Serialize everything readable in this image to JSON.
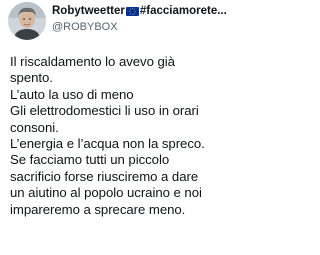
{
  "author": {
    "display_name": "Robytweetter",
    "hashtag": "#facciamorete...",
    "handle": "@ROBYBOX",
    "avatar_icon": "user-avatar-photo",
    "flag_icon": "eu-flag-icon"
  },
  "tweet": {
    "lines": [
      "Il riscaldamento lo avevo già",
      "spento.",
      "L’auto la uso di meno",
      "Gli elettrodomestici li uso in orari",
      "consoni.",
      "L’energia e l’acqua non la spreco.",
      "Se facciamo tutti un piccolo",
      "sacrificio forse riusciremo a dare",
      "un aiutino al popolo ucraino e noi",
      "impareremo a sprecare meno."
    ]
  },
  "colors": {
    "text": "#0f1419",
    "secondary_text": "#536471",
    "eu_blue": "#003399",
    "eu_star": "#ffcc00"
  }
}
